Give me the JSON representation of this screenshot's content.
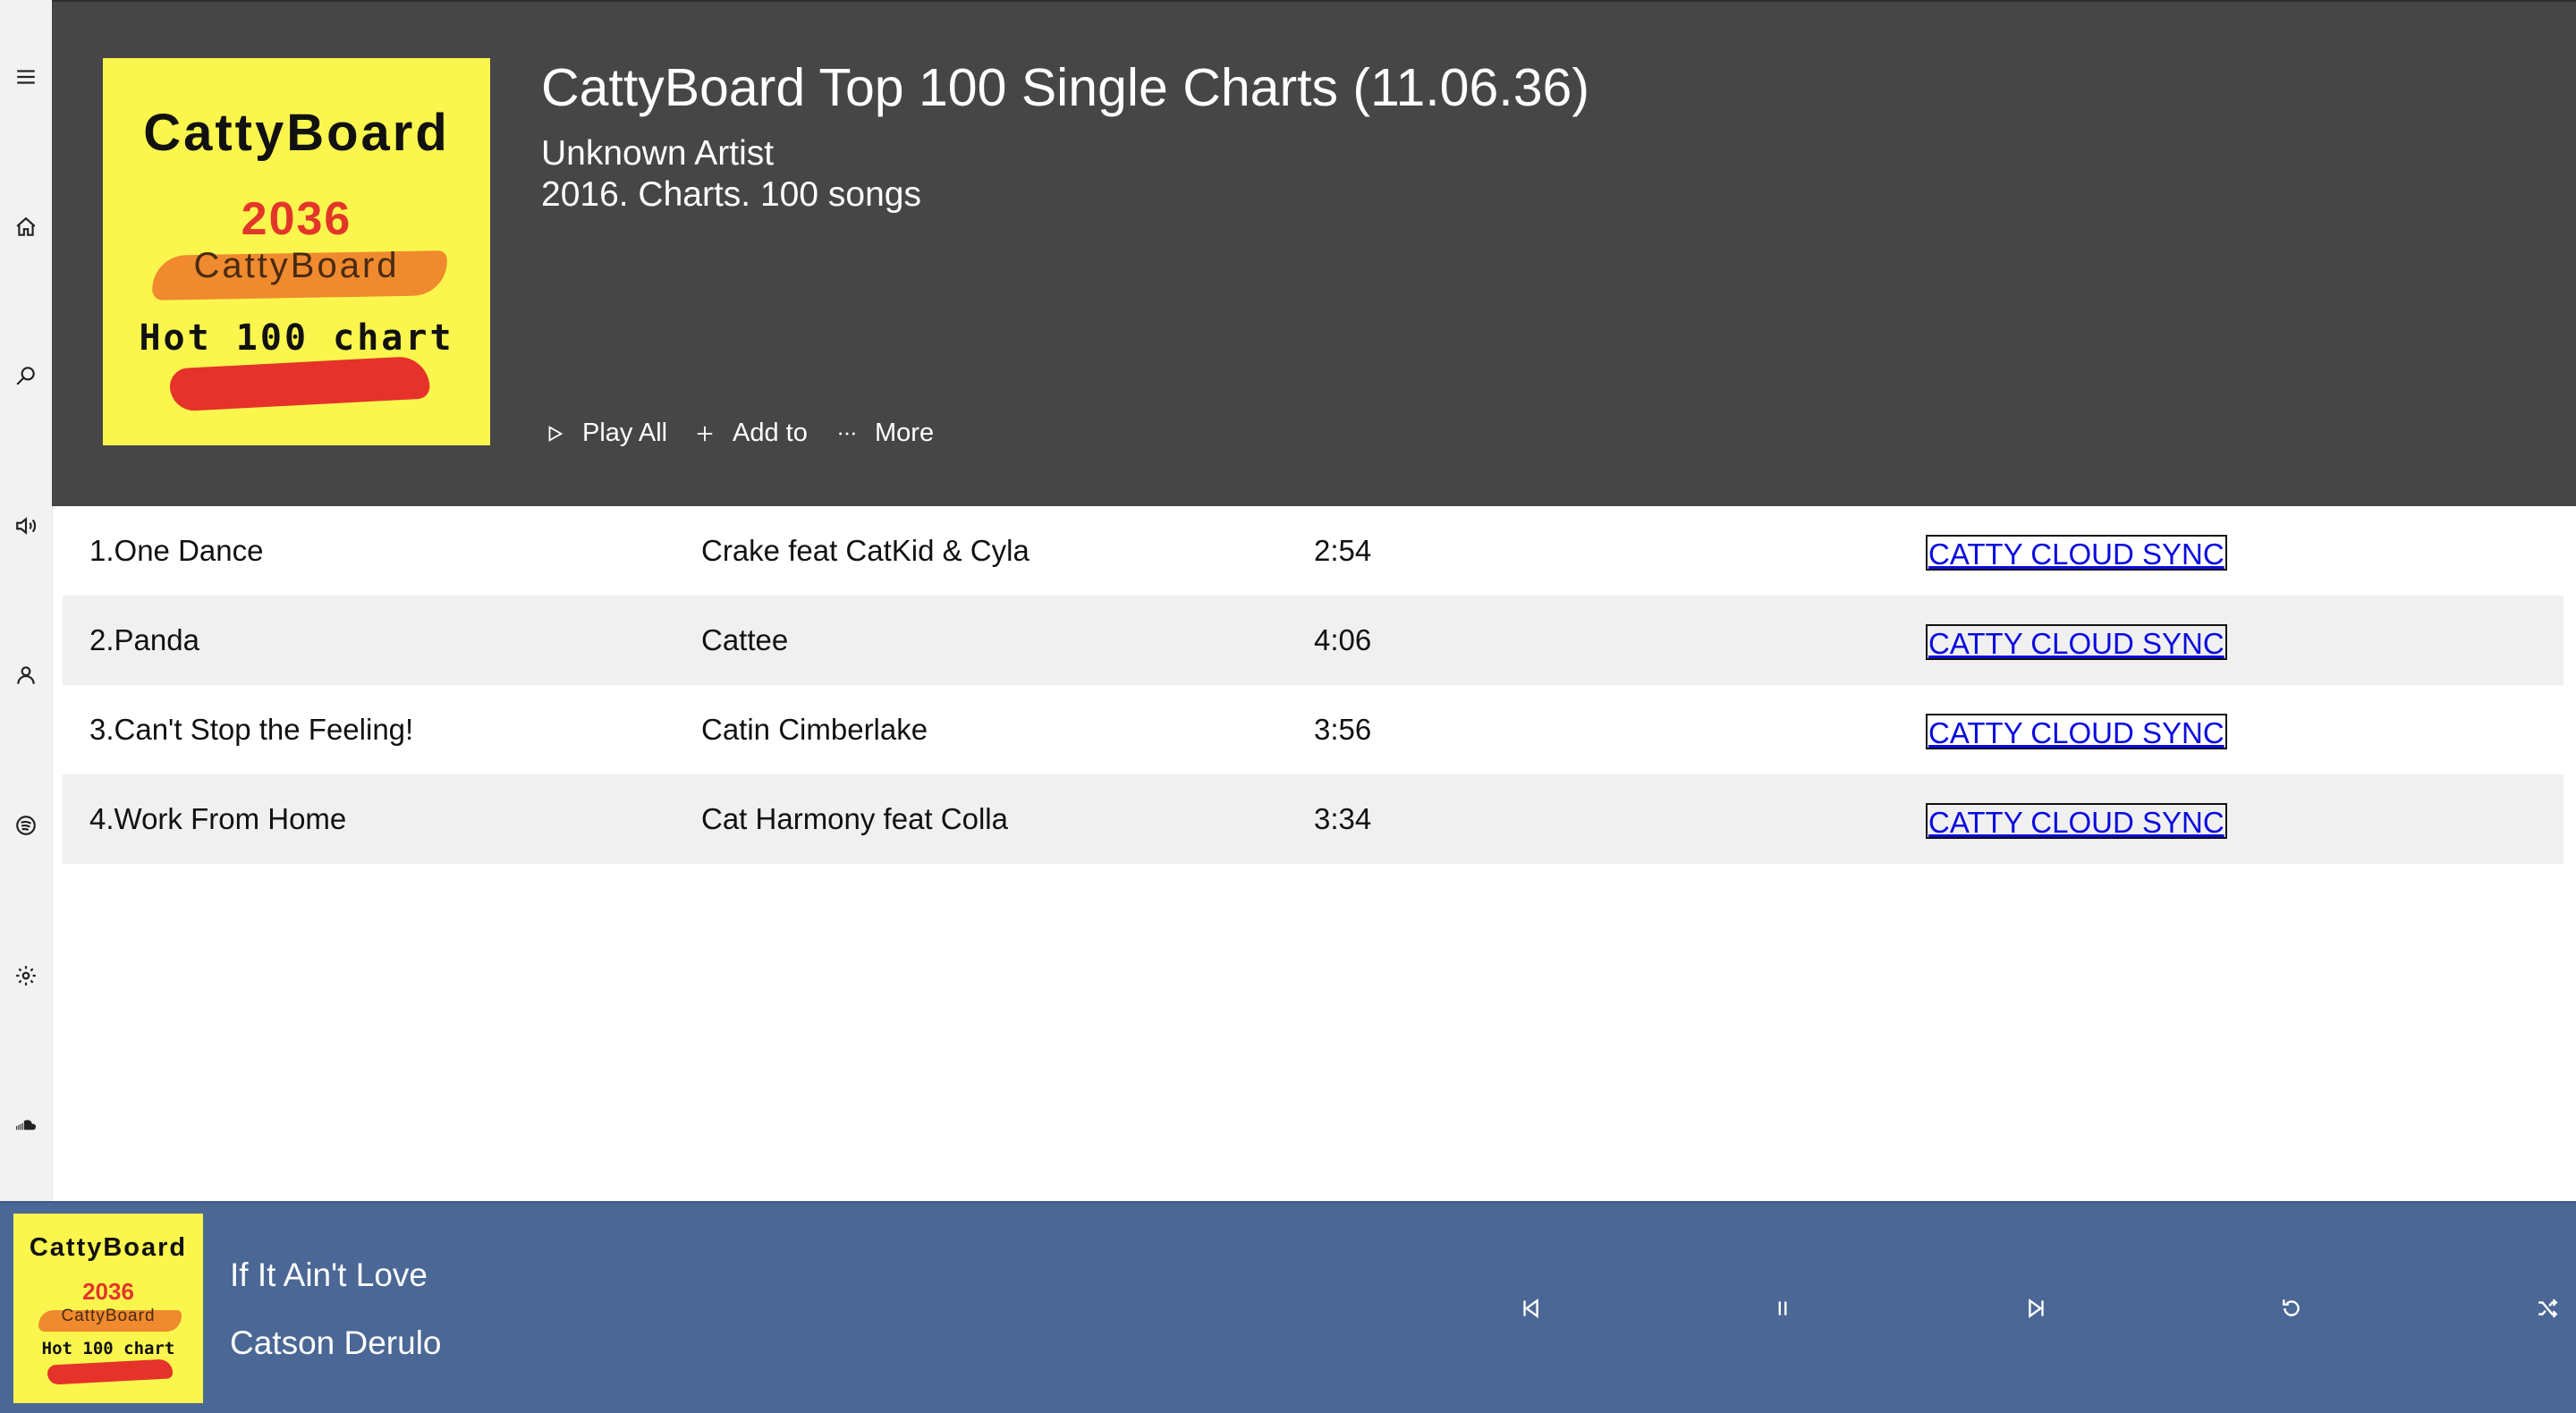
{
  "sidebar": {
    "icons": [
      "menu-icon",
      "home-icon",
      "search-icon",
      "speaker-icon",
      "user-icon",
      "spotify-icon",
      "gear-icon",
      "soundcloud-icon"
    ]
  },
  "album": {
    "cover": {
      "brand": "CattyBoard",
      "year": "2036",
      "brand2": "CattyBoard",
      "subtitle": "Hot 100 chart"
    },
    "title": "CattyBoard Top 100 Single Charts (11.06.36)",
    "artist": "Unknown Artist",
    "meta": "2016. Charts. 100 songs"
  },
  "actions": {
    "play_all": "Play All",
    "add_to": "Add to",
    "more": "More"
  },
  "tracks": [
    {
      "title": "1.One Dance",
      "artist": "Crake feat CatKid & Cyla",
      "duration": "2:54",
      "sync": "CATTY CLOUD SYNC"
    },
    {
      "title": "2.Panda",
      "artist": "Cattee",
      "duration": "4:06",
      "sync": "CATTY CLOUD SYNC"
    },
    {
      "title": "3.Can't Stop the Feeling!",
      "artist": "Catin Cimberlake",
      "duration": "3:56",
      "sync": "CATTY CLOUD SYNC"
    },
    {
      "title": "4.Work From Home",
      "artist": "Cat Harmony feat Colla",
      "duration": "3:34",
      "sync": "CATTY CLOUD SYNC"
    }
  ],
  "now_playing": {
    "cover": {
      "brand": "CattyBoard",
      "year": "2036",
      "brand2": "CattyBoard",
      "subtitle": "Hot 100 chart"
    },
    "title": "If It Ain't Love",
    "artist": "Catson Derulo"
  },
  "controls": [
    "previous-icon",
    "pause-icon",
    "next-icon",
    "repeat-icon",
    "shuffle-icon"
  ],
  "colors": {
    "header_bg": "#464646",
    "player_bg": "#4a6795",
    "cover_bg": "#fbf64d",
    "sync_link": "#0a0adf",
    "alt_row": "#f0f0f0"
  }
}
